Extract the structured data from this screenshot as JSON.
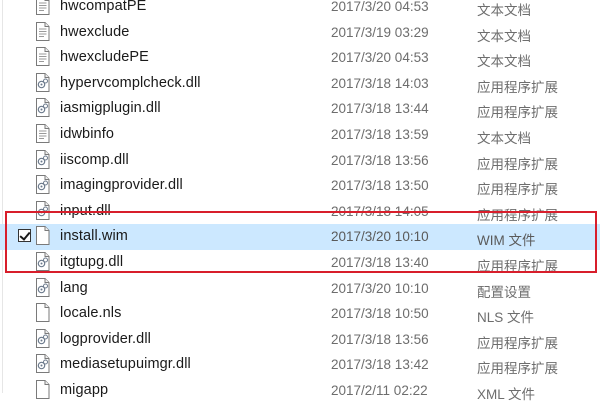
{
  "files": [
    {
      "name": "hwcompatPE",
      "date": "2017/3/20 04:53",
      "type": "文本文档",
      "icon": "text-file-icon"
    },
    {
      "name": "hwexclude",
      "date": "2017/3/19 03:29",
      "type": "文本文档",
      "icon": "text-file-icon"
    },
    {
      "name": "hwexcludePE",
      "date": "2017/3/20 04:53",
      "type": "文本文档",
      "icon": "text-file-icon"
    },
    {
      "name": "hypervcomplcheck.dll",
      "date": "2017/3/18 14:03",
      "type": "应用程序扩展",
      "icon": "dll-file-icon"
    },
    {
      "name": "iasmigplugin.dll",
      "date": "2017/3/18 13:44",
      "type": "应用程序扩展",
      "icon": "dll-file-icon"
    },
    {
      "name": "idwbinfo",
      "date": "2017/3/18 13:59",
      "type": "文本文档",
      "icon": "text-file-icon"
    },
    {
      "name": "iiscomp.dll",
      "date": "2017/3/18 13:56",
      "type": "应用程序扩展",
      "icon": "dll-file-icon"
    },
    {
      "name": "imagingprovider.dll",
      "date": "2017/3/18 13:50",
      "type": "应用程序扩展",
      "icon": "dll-file-icon"
    },
    {
      "name": "input.dll",
      "date": "2017/3/18 14:05",
      "type": "应用程序扩展",
      "icon": "dll-file-icon"
    },
    {
      "name": "install.wim",
      "date": "2017/3/20 10:10",
      "type": "WIM 文件",
      "icon": "blank-file-icon",
      "selected": true,
      "checked": true
    },
    {
      "name": "itgtupg.dll",
      "date": "2017/3/18 13:40",
      "type": "应用程序扩展",
      "icon": "dll-file-icon"
    },
    {
      "name": "lang",
      "date": "2017/3/20 10:10",
      "type": "配置设置",
      "icon": "config-file-icon"
    },
    {
      "name": "locale.nls",
      "date": "2017/3/18 10:50",
      "type": "NLS 文件",
      "icon": "blank-file-icon"
    },
    {
      "name": "logprovider.dll",
      "date": "2017/3/18 13:56",
      "type": "应用程序扩展",
      "icon": "dll-file-icon"
    },
    {
      "name": "mediasetupuimgr.dll",
      "date": "2017/3/18 13:42",
      "type": "应用程序扩展",
      "icon": "dll-file-icon"
    },
    {
      "name": "migapp",
      "date": "2017/2/11 02:22",
      "type": "XML 文件",
      "icon": "blank-file-icon"
    }
  ],
  "colors": {
    "selection": "#cce8ff",
    "annotation_border": "#d81e2b"
  }
}
